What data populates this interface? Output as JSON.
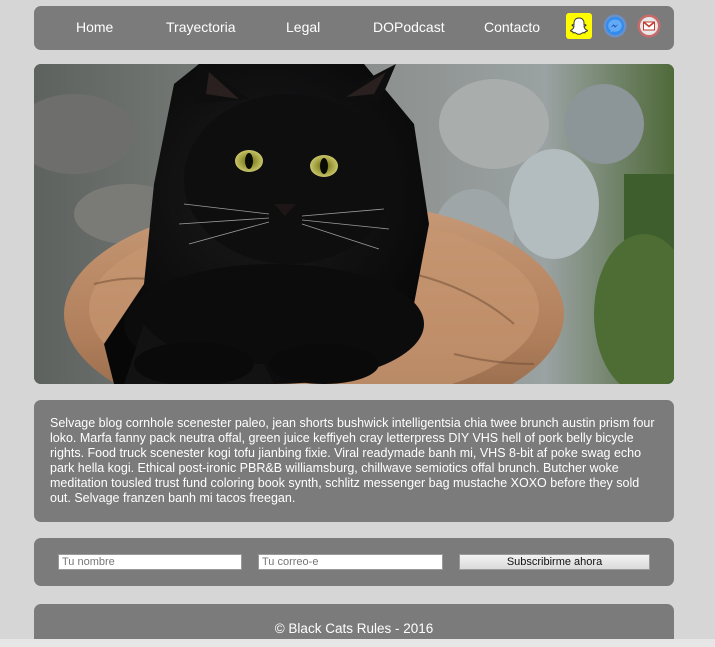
{
  "nav": {
    "items": [
      {
        "label": "Home"
      },
      {
        "label": "Trayectoria"
      },
      {
        "label": "Legal"
      },
      {
        "label": "DOPodcast"
      },
      {
        "label": "Contacto"
      }
    ],
    "social": [
      {
        "icon": "snapchat-icon",
        "color": "#fffc00"
      },
      {
        "icon": "facebook-messenger-icon",
        "color": "#1e88e5"
      },
      {
        "icon": "gmail-icon",
        "color": "#d93025"
      }
    ]
  },
  "hero": {
    "image": "black-cat-photo"
  },
  "content": {
    "paragraph": "Selvage blog cornhole scenester paleo, jean shorts bushwick intelligentsia chia twee brunch austin prism four loko. Marfa fanny pack neutra offal, green juice keffiyeh cray letterpress DIY VHS hell of pork belly bicycle rights. Food truck scenester kogi tofu jianbing fixie. Viral readymade banh mi, VHS 8-bit af poke swag echo park hella kogi. Ethical post-ironic PBR&B williamsburg, chillwave semiotics offal brunch. Butcher woke meditation tousled trust fund coloring book synth, schlitz messenger bag mustache XOXO before they sold out. Selvage franzen banh mi tacos freegan."
  },
  "form": {
    "name_placeholder": "Tu nombre",
    "email_placeholder": "Tu correo-e",
    "submit_label": "Subscribirme ahora"
  },
  "footer": {
    "text": "© Black Cats Rules - 2016"
  }
}
